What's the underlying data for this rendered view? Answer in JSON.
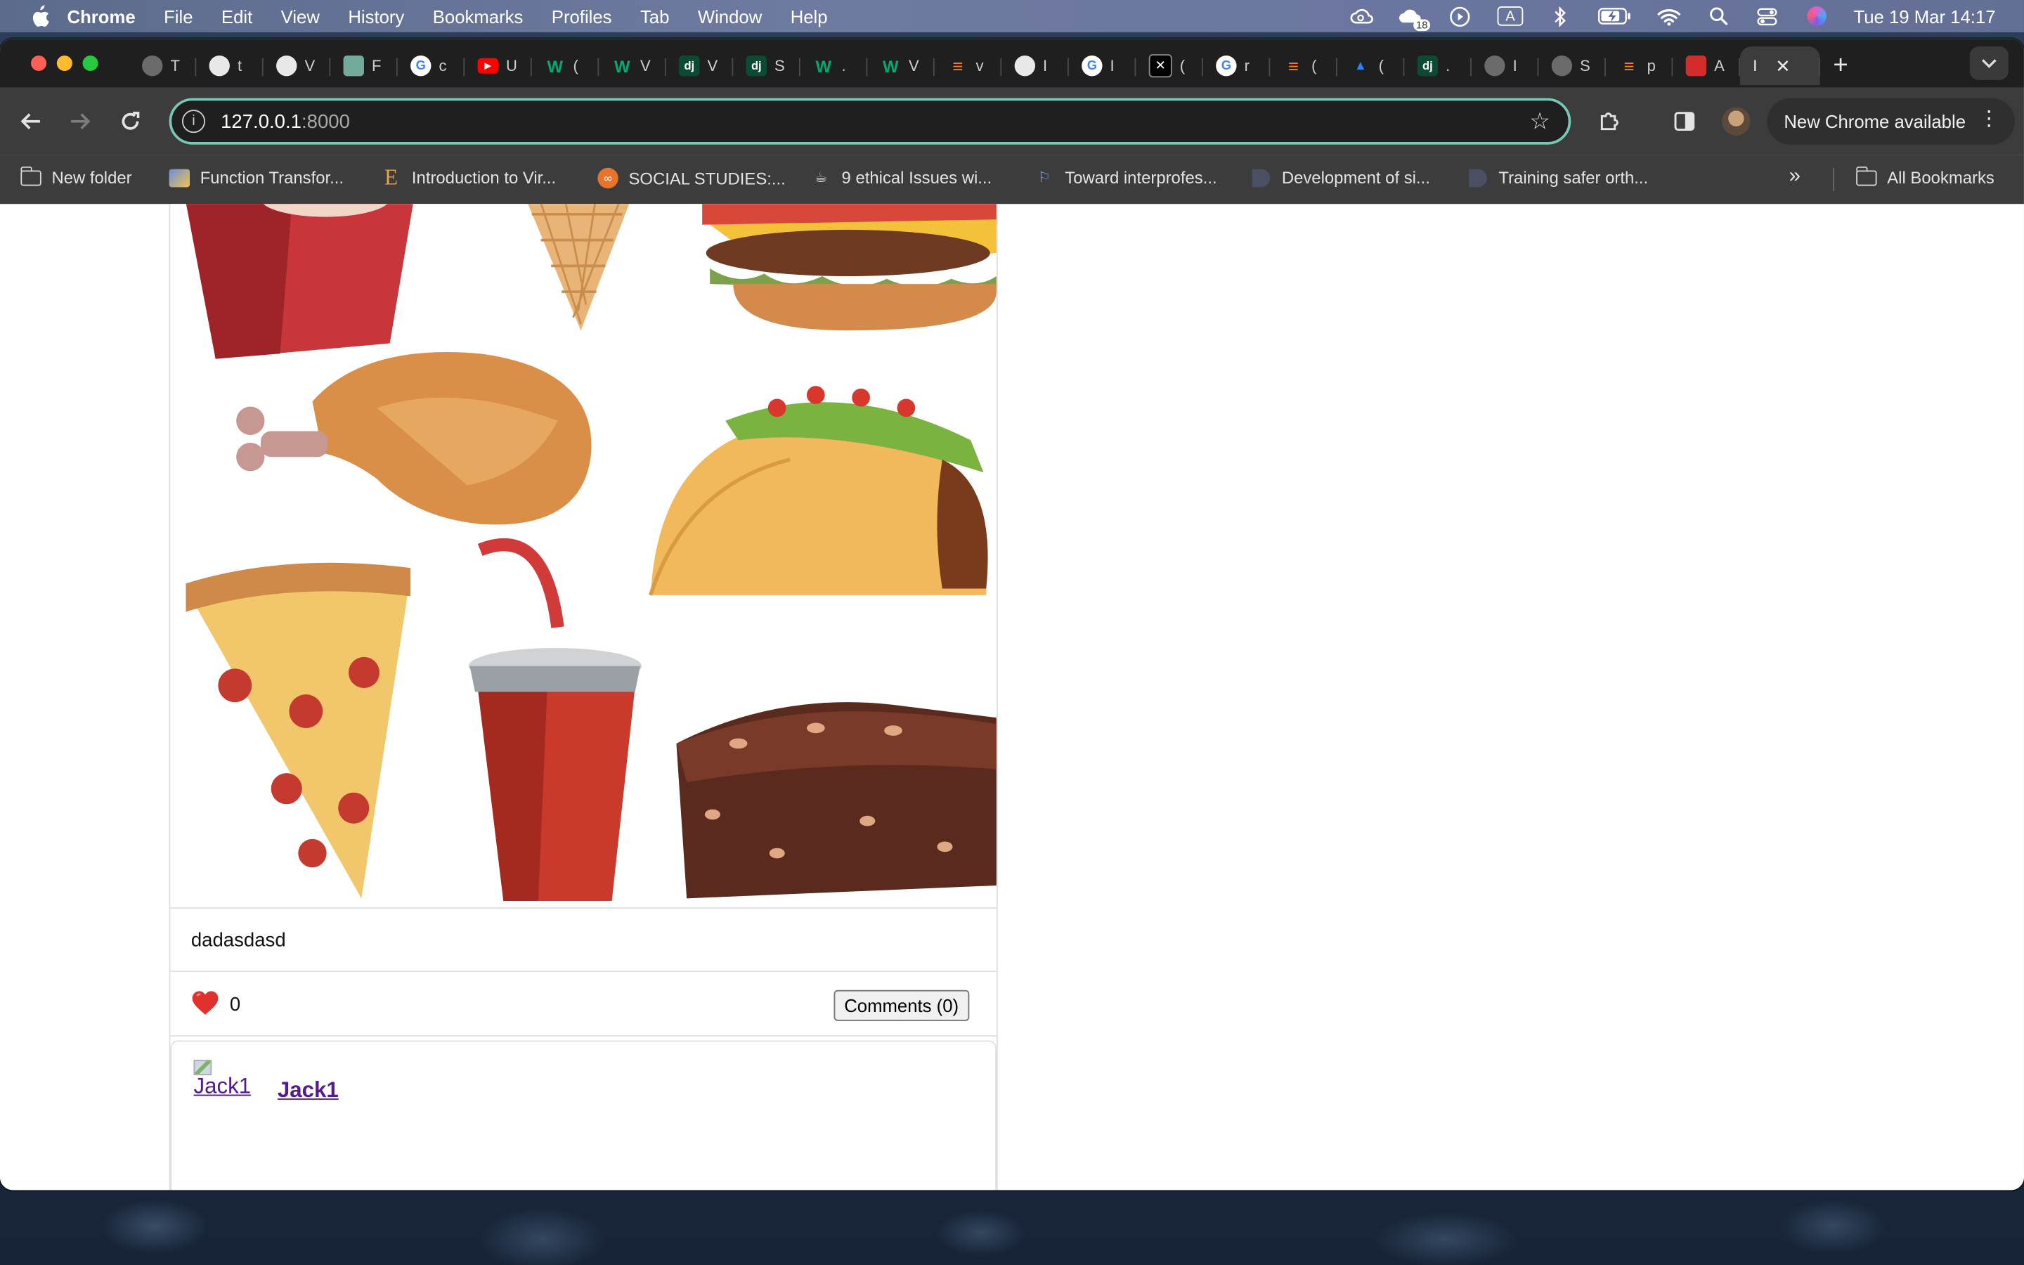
{
  "menubar": {
    "app": "Chrome",
    "items": [
      "File",
      "Edit",
      "View",
      "History",
      "Bookmarks",
      "Profiles",
      "Tab",
      "Window",
      "Help"
    ],
    "status_icons": [
      "creative-cloud-icon",
      "notification-badge-icon",
      "play-icon",
      "keyboard-input-icon",
      "bluetooth-icon",
      "battery-icon",
      "wifi-icon",
      "spotlight-icon",
      "control-center-icon",
      "siri-icon"
    ],
    "notification_count": "18",
    "input_source": "A",
    "clock": "Tue 19 Mar  14:17"
  },
  "tabs": [
    {
      "icon": "globe-icon",
      "letter": "T",
      "color": "#6b6b6b"
    },
    {
      "icon": "github-icon",
      "letter": "t",
      "color": "#e8e8e8"
    },
    {
      "icon": "github-icon",
      "letter": "V",
      "color": "#e8e8e8"
    },
    {
      "icon": "chatgpt-icon",
      "letter": "F",
      "color": "#74aa9c"
    },
    {
      "icon": "google-icon",
      "letter": "c",
      "color": "#ffffff"
    },
    {
      "icon": "youtube-icon",
      "letter": "U",
      "color": "#ff0000"
    },
    {
      "icon": "w3schools-icon",
      "letter": "(",
      "color": "#04aa6d"
    },
    {
      "icon": "w3schools-icon",
      "letter": "V",
      "color": "#04aa6d"
    },
    {
      "icon": "django-icon",
      "letter": "V",
      "color": "#0c4b33"
    },
    {
      "icon": "django-icon",
      "letter": "S",
      "color": "#0c4b33"
    },
    {
      "icon": "w3schools-icon",
      "letter": ".",
      "color": "#04aa6d"
    },
    {
      "icon": "w3schools-icon",
      "letter": "V",
      "color": "#04aa6d"
    },
    {
      "icon": "stackoverflow-icon",
      "letter": "v",
      "color": "#f48024"
    },
    {
      "icon": "chrome-icon",
      "letter": "I",
      "color": "#e8e8e8"
    },
    {
      "icon": "google-icon",
      "letter": "I",
      "color": "#ffffff"
    },
    {
      "icon": "x-icon",
      "letter": "(",
      "color": "#000000"
    },
    {
      "icon": "google-icon",
      "letter": "r",
      "color": "#ffffff"
    },
    {
      "icon": "stackoverflow-icon",
      "letter": "(",
      "color": "#f48024"
    },
    {
      "icon": "atlassian-icon",
      "letter": "(",
      "color": "#2684ff"
    },
    {
      "icon": "django-icon",
      "letter": ".",
      "color": "#0c4b33"
    },
    {
      "icon": "globe-icon",
      "letter": "I",
      "color": "#6b6b6b"
    },
    {
      "icon": "globe-icon",
      "letter": "S",
      "color": "#6b6b6b"
    },
    {
      "icon": "stackoverflow-icon",
      "letter": "p",
      "color": "#f48024"
    },
    {
      "icon": "apple-red-icon",
      "letter": "A",
      "color": "#d42b2b"
    }
  ],
  "active_tab": {
    "letter": "I"
  },
  "toolbar": {
    "url_host": "127.0.0.1",
    "url_port": ":8000",
    "update_label": "New Chrome available"
  },
  "bookmarks": [
    {
      "label": "New folder",
      "icon": "folder-icon"
    },
    {
      "label": "Function Transfor...",
      "icon": "page-icon"
    },
    {
      "label": "Introduction to Vir...",
      "icon": "e-logo-icon"
    },
    {
      "label": "SOCIAL STUDIES:...",
      "icon": "orange-circle-icon"
    },
    {
      "label": "9 ethical Issues wi...",
      "icon": "coffee-icon"
    },
    {
      "label": "Toward interprofes...",
      "icon": "bookmark-icon"
    },
    {
      "label": "Development of si...",
      "icon": "dark-page-icon"
    },
    {
      "label": "Training safer orth...",
      "icon": "dark-page-icon"
    }
  ],
  "all_bookmarks_label": "All Bookmarks",
  "post": {
    "image_alt": "fast-food-illustration",
    "caption": "dadasdasd",
    "like_count": "0",
    "comments_label": "Comments (0)",
    "author_image_alt": "Jack1",
    "author_name": "Jack1"
  },
  "colors": {
    "accent_focus": "#77c8b6",
    "link_visited": "#551a8b",
    "heart": "#e0312d"
  }
}
